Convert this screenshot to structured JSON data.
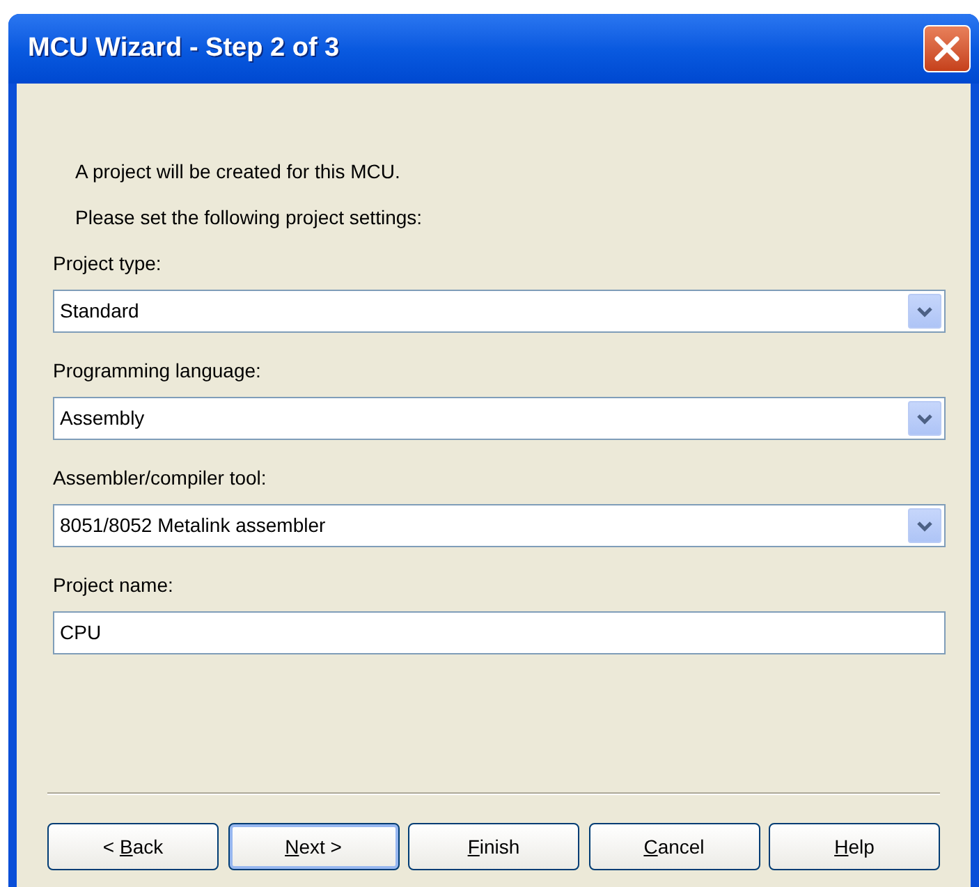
{
  "window": {
    "title": "MCU Wizard - Step 2 of 3"
  },
  "intro": [
    "A project will be created for this MCU.",
    "Please set the following project settings:"
  ],
  "fields": [
    {
      "kind": "dropdown",
      "label": "Project type:",
      "value": "Standard"
    },
    {
      "kind": "dropdown",
      "label": "Programming language:",
      "value": "Assembly"
    },
    {
      "kind": "dropdown",
      "label": "Assembler/compiler tool:",
      "value": "8051/8052 Metalink assembler"
    },
    {
      "kind": "text",
      "label": "Project name:",
      "value": "CPU"
    }
  ],
  "buttons": [
    {
      "prefix": "< ",
      "access_key": "B",
      "suffix": "ack",
      "default": false
    },
    {
      "access_key": "N",
      "suffix": "ext >",
      "default": true
    },
    {
      "access_key": "F",
      "suffix": "inish",
      "default": false
    },
    {
      "access_key": "C",
      "suffix": "ancel",
      "default": false
    },
    {
      "access_key": "H",
      "suffix": "elp",
      "default": false
    }
  ]
}
